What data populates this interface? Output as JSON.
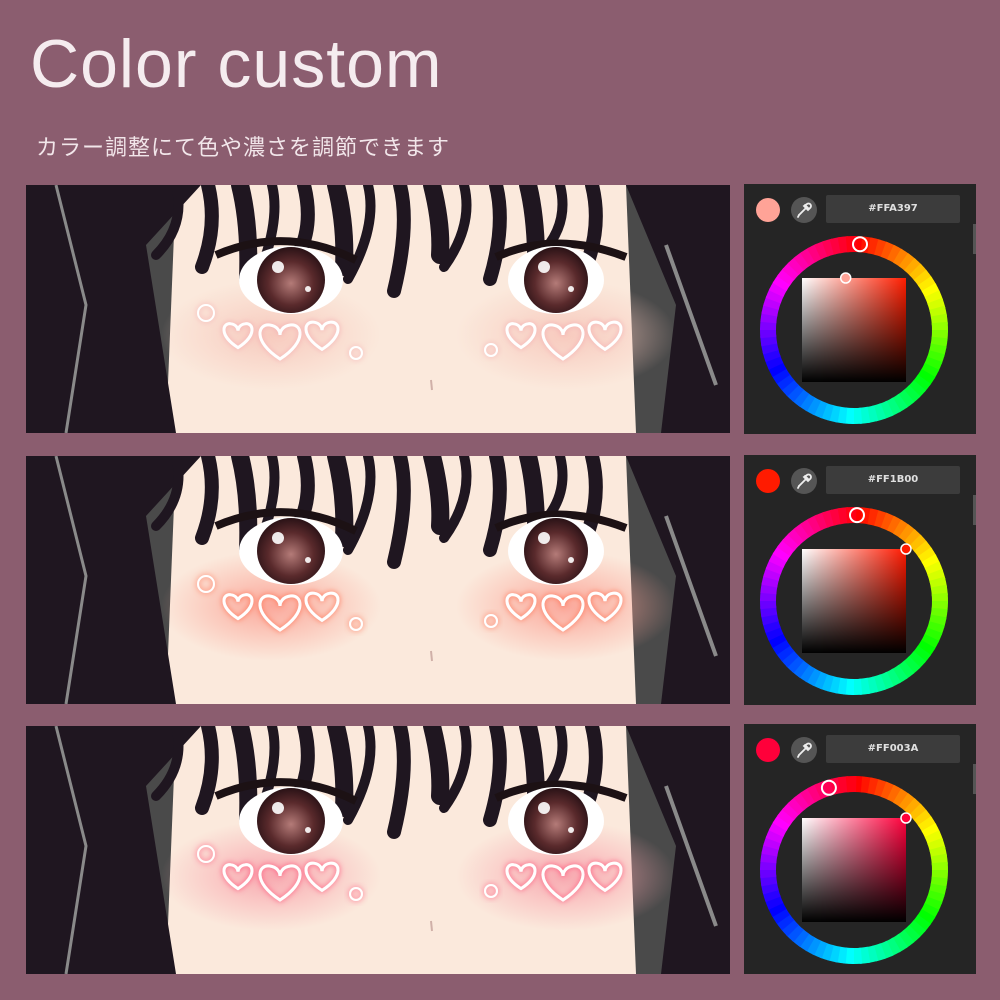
{
  "header": {
    "title": "Color custom",
    "subtitle": "カラー調整にて色や濃さを調節できます"
  },
  "rows": [
    {
      "hex_label": "#FFA397",
      "color": "#FFA397",
      "blush": "#f7c9bd",
      "heart_glow": "#f4a9ae",
      "hue_deg": 7
    },
    {
      "hex_label": "#FF1B00",
      "color": "#FF1B00",
      "blush": "#fba598",
      "heart_glow": "#ff6a4a",
      "hue_deg": 6
    },
    {
      "hex_label": "#FF003A",
      "color": "#FF003A",
      "blush": "#f8a6ae",
      "heart_glow": "#ff4c76",
      "hue_deg": 346
    }
  ],
  "icons": {
    "eyedropper": "eyedropper-icon"
  }
}
